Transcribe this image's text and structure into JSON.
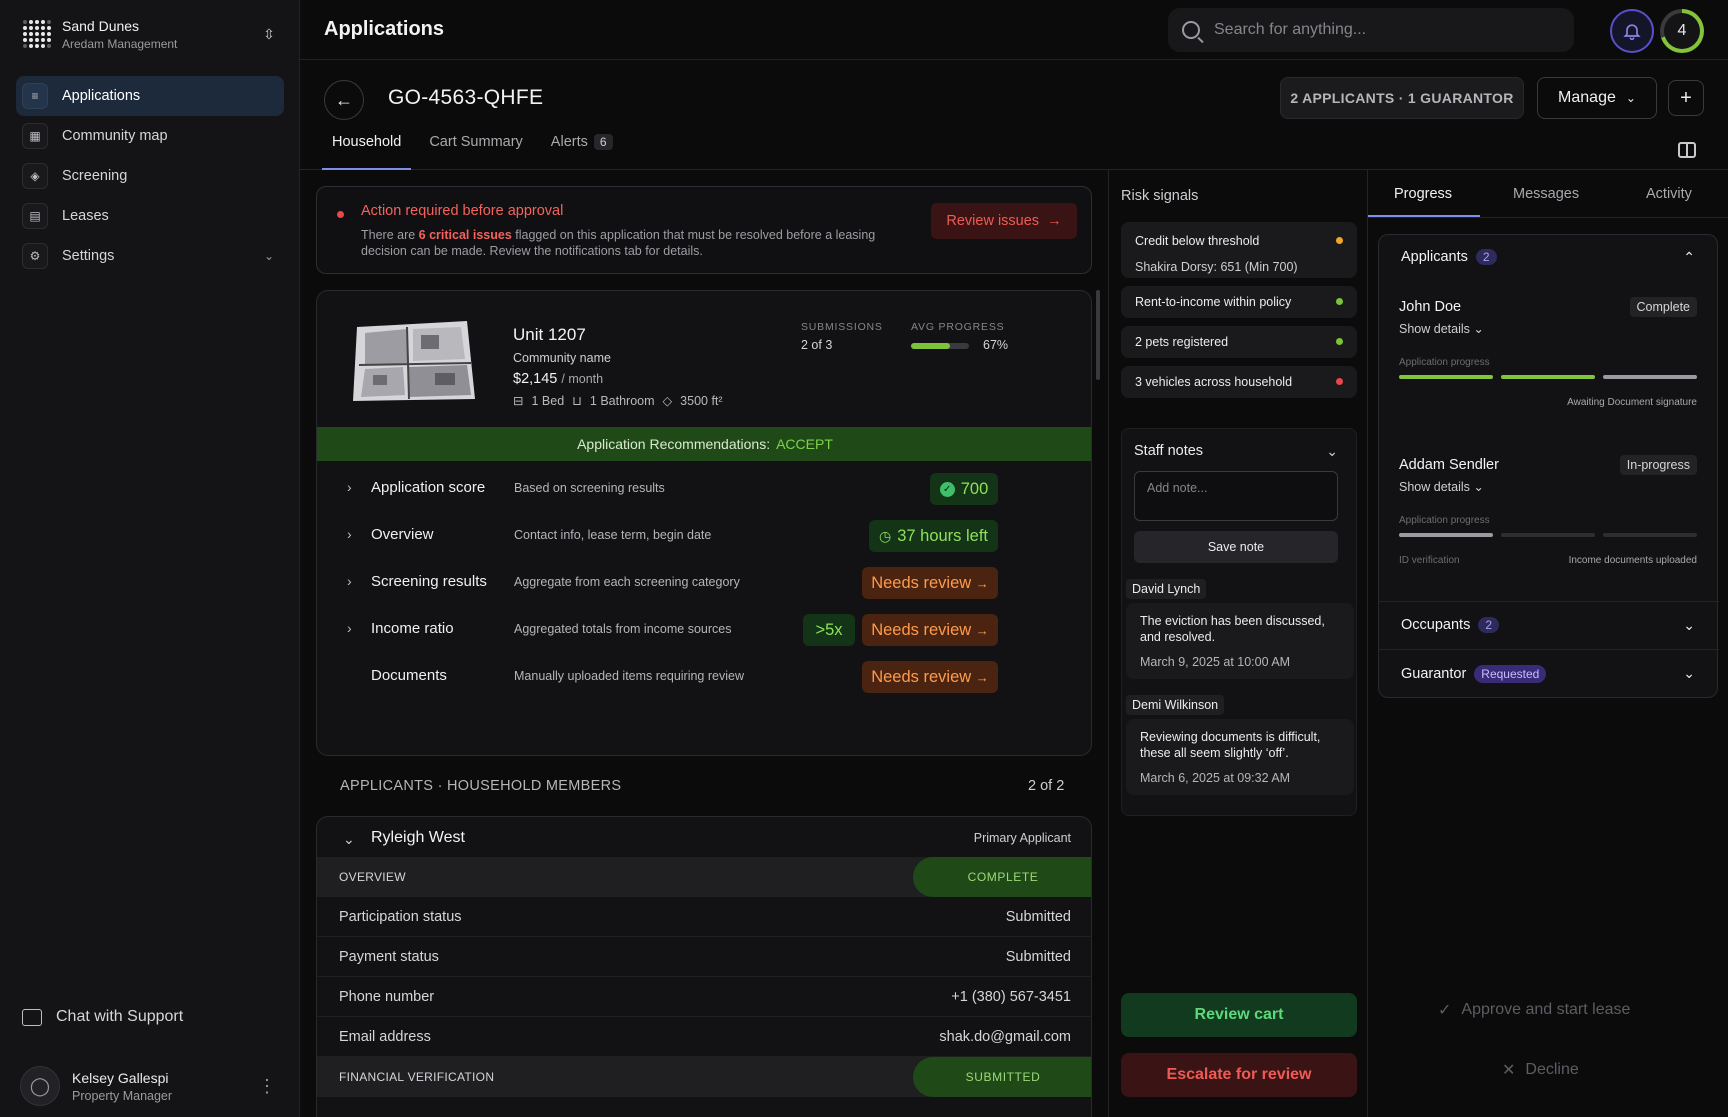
{
  "org": {
    "name": "Sand Dunes",
    "subtitle": "Aredam Management"
  },
  "nav": [
    {
      "label": "Applications",
      "icon": "list-icon",
      "active": true
    },
    {
      "label": "Community map",
      "icon": "building-icon"
    },
    {
      "label": "Screening",
      "icon": "shield-icon"
    },
    {
      "label": "Leases",
      "icon": "document-icon"
    },
    {
      "label": "Settings",
      "icon": "gear-icon"
    }
  ],
  "support": {
    "label": "Chat with Support"
  },
  "user": {
    "name": "Kelsey Gallespi",
    "role": "Property Manager"
  },
  "header": {
    "title": "Applications",
    "search_placeholder": "Search for anything...",
    "notification_count": "4"
  },
  "application": {
    "id": "GO-4563-QHFE",
    "applicants_summary": "2 APPLICANTS · 1 GUARANTOR",
    "manage_label": "Manage",
    "tabs": [
      {
        "label": "Household"
      },
      {
        "label": "Cart Summary"
      },
      {
        "label": "Alerts",
        "badge": "6"
      }
    ]
  },
  "alert": {
    "title": "Action required before approval",
    "body_prefix": "There are ",
    "body_highlight": "6 critical issues",
    "body_suffix": " flagged on this application that must be resolved before a leasing decision can be made. Review the notifications tab for details.",
    "button": "Review issues"
  },
  "unit": {
    "title": "Unit 1207",
    "community": "Community name",
    "price": "$2,145",
    "price_unit": "/ month",
    "beds": "1 Bed",
    "baths": "1 Bathroom",
    "area": "3500 ft²",
    "submissions_label": "SUBMISSIONS",
    "submissions_value": "2 of 3",
    "avg_progress_label": "AVG PROGRESS",
    "avg_progress_value": "67%",
    "avg_progress": 0.67
  },
  "recommendation": {
    "label": "Application Recommendations:",
    "value": "ACCEPT"
  },
  "checks": [
    {
      "title": "Application score",
      "desc": "Based on screening results",
      "badge": "700",
      "kind": "score"
    },
    {
      "title": "Overview",
      "desc": "Contact info, lease term, begin date",
      "badge": "37 hours left",
      "kind": "time"
    },
    {
      "title": "Screening results",
      "desc": "Aggregate from each screening category",
      "badge": "Needs review",
      "kind": "review"
    },
    {
      "title": "Income ratio",
      "desc": "Aggregated totals from income sources",
      "badge": "Needs review",
      "extra": ">5x",
      "kind": "review"
    },
    {
      "title": "Documents",
      "desc": "Manually uploaded items requiring review",
      "badge": "Needs review",
      "kind": "review"
    }
  ],
  "household": {
    "heading": "APPLICANTS · HOUSEHOLD MEMBERS",
    "count": "2 of 2"
  },
  "member": {
    "name": "Ryleigh West",
    "role": "Primary Applicant",
    "overview_label": "OVERVIEW",
    "overview_status": "COMPLETE",
    "rows": [
      {
        "k": "Participation status",
        "v": "Submitted"
      },
      {
        "k": "Payment status",
        "v": "Submitted"
      },
      {
        "k": "Phone number",
        "v": "+1 (380) 567-3451"
      },
      {
        "k": "Email address",
        "v": "shak.do@gmail.com"
      }
    ],
    "financial_label": "FINANCIAL VERIFICATION",
    "financial_status": "SUBMITTED"
  },
  "risk": {
    "title": "Risk signals",
    "items": [
      {
        "title": "Credit below threshold",
        "sub": "Shakira Dorsy: 651 (Min 700)",
        "color": "#f5a524"
      },
      {
        "title": "Rent-to-income within policy",
        "color": "#7ec23a"
      },
      {
        "title": "2 pets registered",
        "color": "#7ec23a"
      },
      {
        "title": "3 vehicles across household",
        "color": "#e5484d"
      }
    ]
  },
  "notes": {
    "title": "Staff notes",
    "placeholder": "Add note...",
    "save_label": "Save note",
    "comments": [
      {
        "author": "David Lynch",
        "text": "The eviction has been discussed, and resolved.",
        "date": "March 9, 2025 at 10:00 AM"
      },
      {
        "author": "Demi Wilkinson",
        "text": "Reviewing documents is difficult, these all seem slightly ‘off’.",
        "date": "March 6, 2025 at 09:32 AM"
      }
    ]
  },
  "actions": {
    "review_cart": "Review cart",
    "escalate": "Escalate for review",
    "approve": "Approve and start lease",
    "decline": "Decline"
  },
  "right": {
    "tabs": [
      "Progress",
      "Messages",
      "Activity"
    ],
    "applicants_title": "Applicants",
    "applicants_count": "2",
    "applicants": [
      {
        "name": "John Doe",
        "status": "Complete",
        "show": "Show details",
        "progress_label": "Application progress",
        "note": "Awaiting Document signature"
      },
      {
        "name": "Addam Sendler",
        "status": "In-progress",
        "show": "Show details",
        "progress_label": "Application progress",
        "left_note": "ID verification",
        "note": "Income documents uploaded"
      }
    ],
    "occupants_title": "Occupants",
    "occupants_count": "2",
    "guarantor_title": "Guarantor",
    "guarantor_status": "Requested"
  },
  "colors": {
    "accent": "#7d8fe6",
    "success": "#7ec23a",
    "danger": "#e5484d",
    "warning": "#ff9a4a"
  }
}
